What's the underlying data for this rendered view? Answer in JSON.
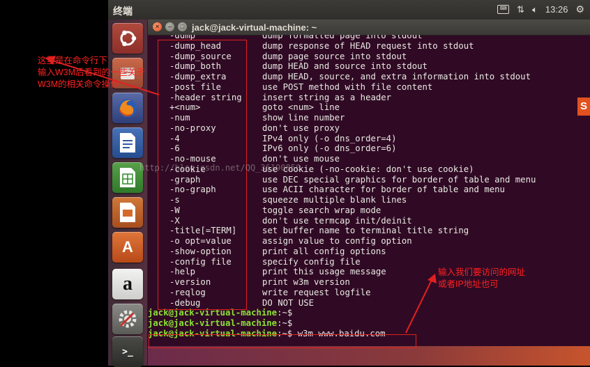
{
  "top_panel": {
    "title": "终端",
    "time": "13:26"
  },
  "window": {
    "title": "jack@jack-virtual-machine: ~",
    "close_glyph": "×",
    "min_glyph": "–",
    "max_glyph": "□"
  },
  "launcher": {
    "items": [
      {
        "icon": "ubuntu-dash-icon"
      },
      {
        "icon": "files-icon"
      },
      {
        "icon": "firefox-icon"
      },
      {
        "icon": "libreoffice-writer-icon"
      },
      {
        "icon": "libreoffice-calc-icon"
      },
      {
        "icon": "libreoffice-impress-icon"
      },
      {
        "icon": "software-center-icon"
      },
      {
        "icon": "amazon-icon"
      },
      {
        "icon": "system-settings-icon"
      },
      {
        "icon": "terminal-icon"
      }
    ],
    "amazon_letter": "a",
    "software_letter": "A",
    "terminal_glyph": ">_"
  },
  "terminal": {
    "help_rows": [
      {
        "opt": "-dump",
        "desc": "dump formatted page into stdout"
      },
      {
        "opt": "-dump_head",
        "desc": "dump response of HEAD request into stdout"
      },
      {
        "opt": "-dump_source",
        "desc": "dump page source into stdout"
      },
      {
        "opt": "-dump_both",
        "desc": "dump HEAD and source into stdout"
      },
      {
        "opt": "-dump_extra",
        "desc": "dump HEAD, source, and extra information into stdout"
      },
      {
        "opt": "-post file",
        "desc": "use POST method with file content"
      },
      {
        "opt": "-header string",
        "desc": "insert string as a header"
      },
      {
        "opt": "+<num>",
        "desc": "goto <num> line"
      },
      {
        "opt": "-num",
        "desc": "show line number"
      },
      {
        "opt": "-no-proxy",
        "desc": "don't use proxy"
      },
      {
        "opt": "-4",
        "desc": "IPv4 only (-o dns_order=4)"
      },
      {
        "opt": "-6",
        "desc": "IPv6 only (-o dns_order=6)"
      },
      {
        "opt": "-no-mouse",
        "desc": "don't use mouse"
      },
      {
        "opt": "-cookie",
        "desc": "use cookie (-no-cookie: don't use cookie)"
      },
      {
        "opt": "-graph",
        "desc": "use DEC special graphics for border of table and menu"
      },
      {
        "opt": "-no-graph",
        "desc": "use ACII character for border of table and menu"
      },
      {
        "opt": "-s",
        "desc": "squeeze multiple blank lines"
      },
      {
        "opt": "-W",
        "desc": "toggle search wrap mode"
      },
      {
        "opt": "-X",
        "desc": "don't use termcap init/deinit"
      },
      {
        "opt": "-title[=TERM]",
        "desc": "set buffer name to terminal title string"
      },
      {
        "opt": "-o opt=value",
        "desc": "assign value to config option"
      },
      {
        "opt": "-show-option",
        "desc": "print all config options"
      },
      {
        "opt": "-config file",
        "desc": "specify config file"
      },
      {
        "opt": "-help",
        "desc": "print this usage message"
      },
      {
        "opt": "-version",
        "desc": "print w3m version"
      },
      {
        "opt": "-reqlog",
        "desc": "write request logfile"
      },
      {
        "opt": "-debug",
        "desc": "DO NOT USE"
      }
    ],
    "prompts": [
      {
        "user": "jack@jack-virtual-machine",
        "suffix": ":~$",
        "command": ""
      },
      {
        "user": "jack@jack-virtual-machine",
        "suffix": ":~$",
        "command": ""
      },
      {
        "user": "jack@jack-virtual-machine",
        "suffix": ":~$",
        "command": " w3m www.baidu.com"
      }
    ]
  },
  "annotations": {
    "left_note": "这里是在命令行下\n输入W3M后看到的一些关于\nW3M的相关命令操作",
    "right_note": "输入我们要访问的网址\n或者IP地址也可",
    "watermark": "http://blog.csdn.net/QQ_36190850"
  },
  "colors": {
    "terminal_bg": "#300a24",
    "prompt_green": "#8ae234",
    "annotation_red": "#e02020"
  }
}
